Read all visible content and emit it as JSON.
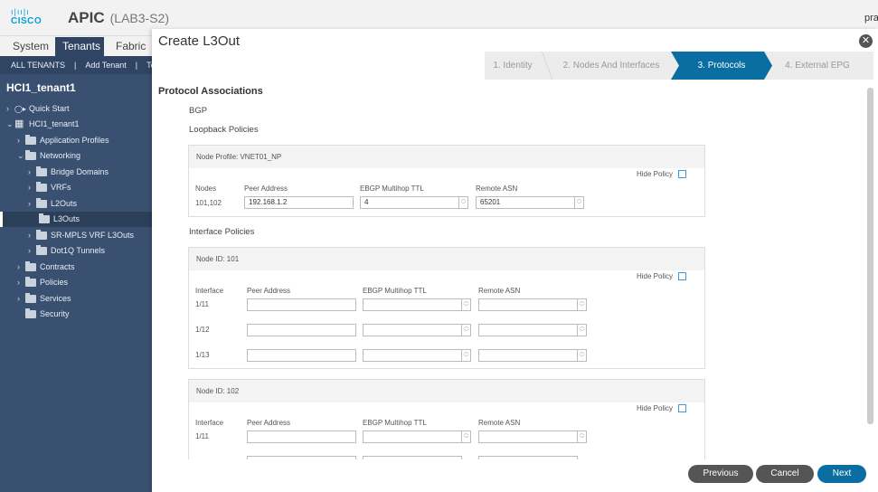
{
  "header": {
    "logo": "cisco",
    "app": "APIC",
    "site": "(LAB3-S2)",
    "user": "pra"
  },
  "nav_tabs": [
    "System",
    "Tenants",
    "Fabric"
  ],
  "subbar": [
    "ALL TENANTS",
    "|",
    "Add Tenant",
    "|",
    "Te"
  ],
  "tenant_name": "HCI1_tenant1",
  "tree": [
    {
      "label": "Quick Start",
      "level": 0
    },
    {
      "label": "HCI1_tenant1",
      "level": 0
    },
    {
      "label": "Application Profiles",
      "level": 1
    },
    {
      "label": "Networking",
      "level": 1
    },
    {
      "label": "Bridge Domains",
      "level": 2
    },
    {
      "label": "VRFs",
      "level": 2
    },
    {
      "label": "L2Outs",
      "level": 2
    },
    {
      "label": "L3Outs",
      "level": 2
    },
    {
      "label": "SR-MPLS VRF L3Outs",
      "level": 2
    },
    {
      "label": "Dot1Q Tunnels",
      "level": 2
    },
    {
      "label": "Contracts",
      "level": 1
    },
    {
      "label": "Policies",
      "level": 1
    },
    {
      "label": "Services",
      "level": 1
    },
    {
      "label": "Security",
      "level": 1
    }
  ],
  "modal": {
    "title": "Create L3Out",
    "close_icon": "close-icon",
    "steps": [
      "1. Identity",
      "2. Nodes And Interfaces",
      "3. Protocols",
      "4. External EPG"
    ],
    "active_step": 2,
    "section": "Protocol Associations",
    "bgp": "BGP",
    "loopback_label": "Loopback Policies",
    "node_profile": "Node Profile: VNET01_NP",
    "hide_policy": "Hide Policy",
    "cols": {
      "nodes": "Nodes",
      "interface": "Interface",
      "peer": "Peer Address",
      "ttl": "EBGP Multihop TTL",
      "asn": "Remote ASN"
    },
    "loopback_row": {
      "nodes": "101,102",
      "peer": "192.168.1.2",
      "ttl": "4",
      "asn": "65201"
    },
    "interface_label": "Interface Policies",
    "node101": "Node ID: 101",
    "node101_ifaces": [
      "1/11",
      "1/12",
      "1/13"
    ],
    "node102": "Node ID: 102",
    "node102_ifaces": [
      "1/11"
    ],
    "buttons": {
      "previous": "Previous",
      "cancel": "Cancel",
      "next": "Next"
    }
  }
}
